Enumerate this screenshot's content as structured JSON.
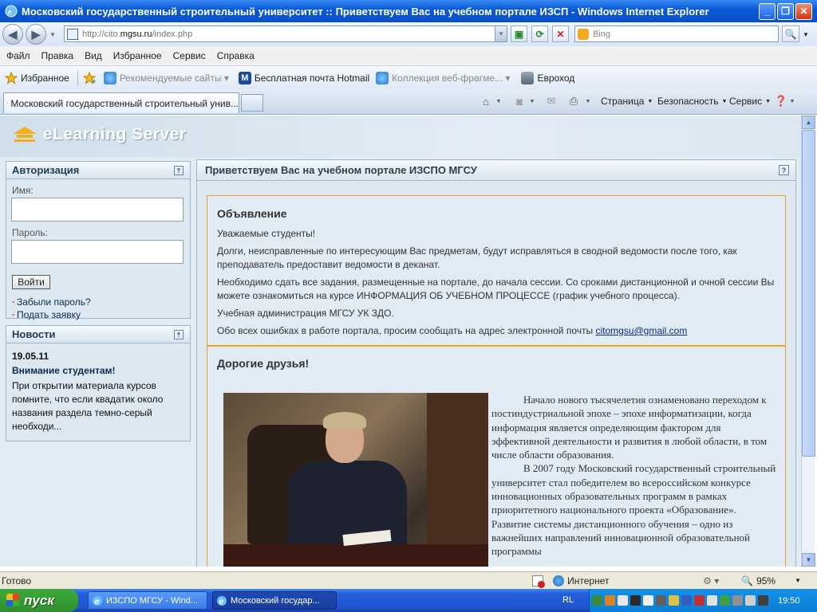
{
  "window": {
    "title": "Московский государственный строительный университет :: Приветствуем Вас на учебном портале ИЗСП - Windows Internet Explorer"
  },
  "address": {
    "url_prefix": "http://cito.",
    "url_domain": "mgsu.ru",
    "url_path": "/index.php",
    "search_placeholder": "Bing"
  },
  "menu": [
    "Файл",
    "Правка",
    "Вид",
    "Избранное",
    "Сервис",
    "Справка"
  ],
  "favorites": {
    "label": "Избранное",
    "items": [
      {
        "label": "Рекомендуемые сайты ▾",
        "dim": true
      },
      {
        "label": "Бесплатная почта Hotmail",
        "dim": false
      },
      {
        "label": "Коллекция веб-фрагме... ▾",
        "dim": true
      },
      {
        "label": "Евроход",
        "dim": false
      }
    ]
  },
  "tab": {
    "label": "Московский государственный строительный унив..."
  },
  "commands": {
    "page": "Страница",
    "security": "Безопасность",
    "service": "Сервис"
  },
  "site": {
    "logo": "eLearning Server"
  },
  "auth": {
    "title": "Авторизация",
    "name_label": "Имя:",
    "password_label": "Пароль:",
    "login_button": "Войти",
    "forgot": "Забыли пароль?",
    "apply": "Подать заявку"
  },
  "news": {
    "title": "Новости",
    "date": "19.05.11",
    "headline": "Внимание студентам!",
    "text": "При открытии материала курсов помните, что если квадатик около названия раздела темно-серый необходи..."
  },
  "main": {
    "title": "Приветствуем Вас на учебном портале ИЗСПО МГСУ",
    "announce_title": "Объявление",
    "p1": "Уважаемые студенты!",
    "p2": "Долги, неисправленные по интересующим Вас предметам, будут исправляться в сводной ведомости после того, как преподаватель предоставит ведомости в деканат.",
    "p3": "Необходимо сдать все задания, размещенные на портале, до начала сессии. Со сроками дистанционной и очной сессии Вы можете ознакомиться на курсе ИНФОРМАЦИЯ ОБ УЧЕБНОМ ПРОЦЕССЕ (график учебного процесса).",
    "p4": "Учебная администрация МГСУ УК ЗДО.",
    "p5": "Обо всех ошибках в работе портала, просим сообщать на адрес электронной почты ",
    "email": "citomgsu@gmail.com",
    "friends_title": "Дорогие друзья!",
    "article_p1": "Начало нового тысячелетия ознаменовано переходом к постиндустриальной эпохе – эпохе информатизации, когда информация является определяющим фактором для эффективной деятельности и развития в любой области, в том числе области образования.",
    "article_p2": "В 2007 году Московский государственный строительный университет  стал победителем во всероссийском конкурсе инновационных образовательных программ в рамках приоритетного национального проекта «Образование». Развитие системы дистанционного обучения – одно из важнейших направлений инновационной образовательной программы"
  },
  "status": {
    "text": "Готово",
    "zone": "Интернет",
    "zoom": "95%"
  },
  "taskbar": {
    "start": "пуск",
    "tasks": [
      "ИЗСПО МГСУ - Wind...",
      "Московский государ..."
    ],
    "lang": "RL",
    "clock": "19:50"
  },
  "colors": {
    "titlebar": "#0a5bd8",
    "accent_border": "#e4a52a",
    "panel_bg": "#dde8f1",
    "link": "#0b2a52"
  }
}
